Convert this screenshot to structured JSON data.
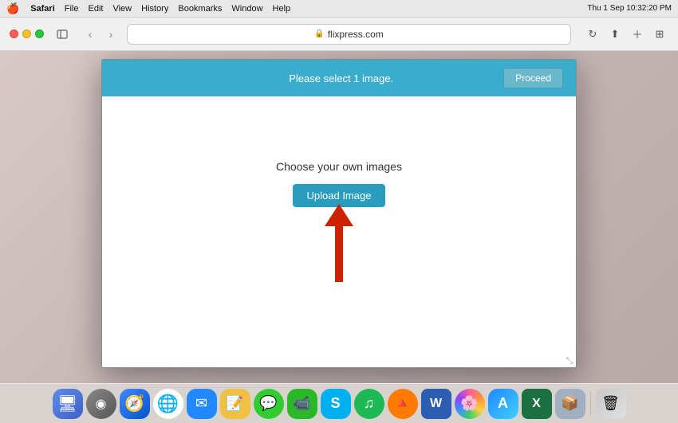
{
  "menubar": {
    "apple": "🍎",
    "app_name": "Safari",
    "menus": [
      "Safari",
      "File",
      "Edit",
      "View",
      "History",
      "Bookmarks",
      "Window",
      "Help"
    ],
    "right": {
      "datetime": "Thu 1 Sep  10:32:20 PM"
    }
  },
  "browser": {
    "url": "flixpress.com",
    "reload_title": "Reload page"
  },
  "modal": {
    "header_title": "Please select 1 image.",
    "proceed_label": "Proceed",
    "choose_label": "Choose your own images",
    "upload_label": "Upload Image"
  },
  "dock": {
    "items": [
      {
        "name": "finder",
        "icon": "🖥",
        "label": "Finder"
      },
      {
        "name": "siri",
        "icon": "◉",
        "label": "Siri"
      },
      {
        "name": "safari",
        "icon": "⊕",
        "label": "Safari"
      },
      {
        "name": "chrome",
        "icon": "◎",
        "label": "Chrome"
      },
      {
        "name": "mail",
        "icon": "✉",
        "label": "Mail"
      },
      {
        "name": "notes",
        "icon": "📝",
        "label": "Notes"
      },
      {
        "name": "messages",
        "icon": "💬",
        "label": "Messages"
      },
      {
        "name": "facetime",
        "icon": "📷",
        "label": "FaceTime"
      },
      {
        "name": "skype",
        "icon": "S",
        "label": "Skype"
      },
      {
        "name": "spotify",
        "icon": "♫",
        "label": "Spotify"
      },
      {
        "name": "vlc",
        "icon": "🔺",
        "label": "VLC"
      },
      {
        "name": "word",
        "icon": "W",
        "label": "Word"
      },
      {
        "name": "photos",
        "icon": "⊛",
        "label": "Photos"
      },
      {
        "name": "appstore",
        "icon": "A",
        "label": "App Store"
      },
      {
        "name": "excel",
        "icon": "X",
        "label": "Excel"
      },
      {
        "name": "trash",
        "icon": "🗑",
        "label": "Trash"
      }
    ]
  }
}
